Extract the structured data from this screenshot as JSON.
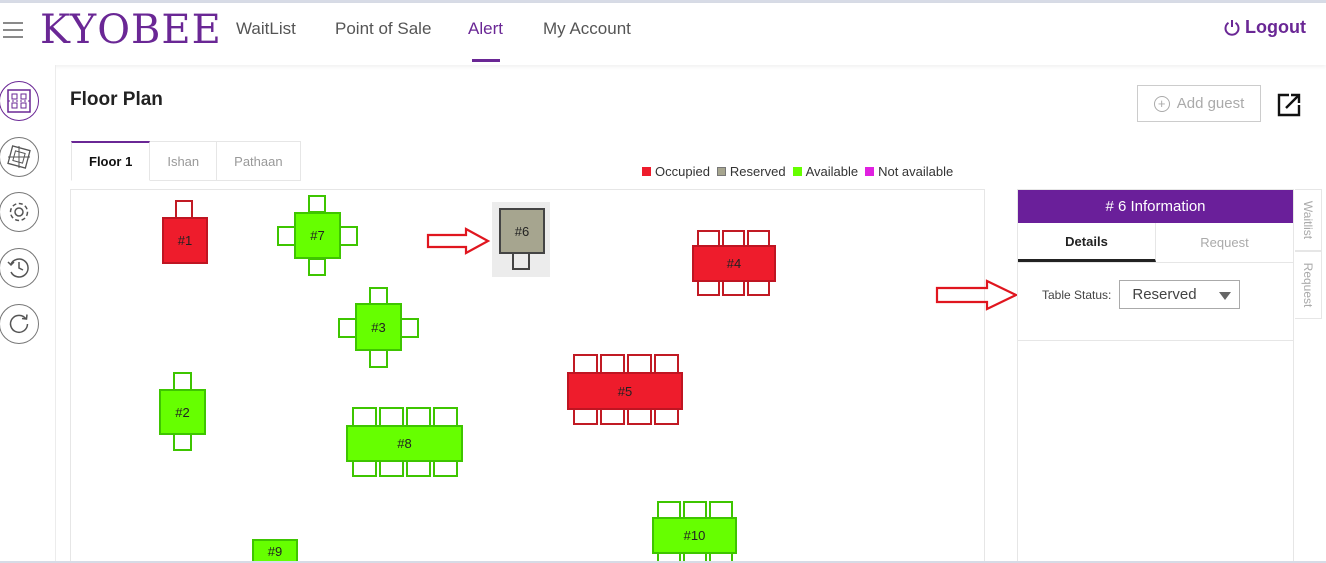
{
  "app": {
    "logo": "KYOBEE"
  },
  "nav": {
    "items": [
      "WaitList",
      "Point of Sale",
      "Alert",
      "My Account"
    ],
    "active": "Alert",
    "logout": "Logout"
  },
  "colors": {
    "brand": "#6a2795",
    "occupied": "#ee1c2c",
    "reserved": "#a6a58f",
    "available": "#66ff00",
    "not_available": "#e020e0"
  },
  "sidebar": {
    "icons": [
      "floor-plan-icon",
      "table-layout-icon",
      "settings-gear-icon",
      "history-clock-icon",
      "refresh-icon"
    ],
    "active": "floor-plan-icon"
  },
  "page": {
    "title": "Floor Plan",
    "add_guest": "Add guest",
    "popout_icon": "external-link-icon"
  },
  "floor_tabs": [
    "Floor 1",
    "Ishan",
    "Pathaan"
  ],
  "active_floor_tab": "Floor 1",
  "legend": [
    {
      "label": "Occupied",
      "color": "#ee1c2c"
    },
    {
      "label": "Reserved",
      "color": "#a6a58f"
    },
    {
      "label": "Available",
      "color": "#66ff00"
    },
    {
      "label": "Not available",
      "color": "#e020e0"
    }
  ],
  "tables": [
    {
      "label": "#1",
      "status": "occupied"
    },
    {
      "label": "#7",
      "status": "available"
    },
    {
      "label": "#6",
      "status": "reserved",
      "selected": true
    },
    {
      "label": "#4",
      "status": "occupied"
    },
    {
      "label": "#3",
      "status": "available"
    },
    {
      "label": "#2",
      "status": "available"
    },
    {
      "label": "#5",
      "status": "occupied"
    },
    {
      "label": "#8",
      "status": "available"
    },
    {
      "label": "#10",
      "status": "available"
    },
    {
      "label": "#9",
      "status": "available"
    }
  ],
  "info_panel": {
    "title": "# 6 Information",
    "tabs": [
      "Details",
      "Request"
    ],
    "active_tab": "Details",
    "status_label": "Table Status:",
    "status_value": "Reserved"
  },
  "side_tabs": [
    "Waitlist",
    "Request"
  ]
}
